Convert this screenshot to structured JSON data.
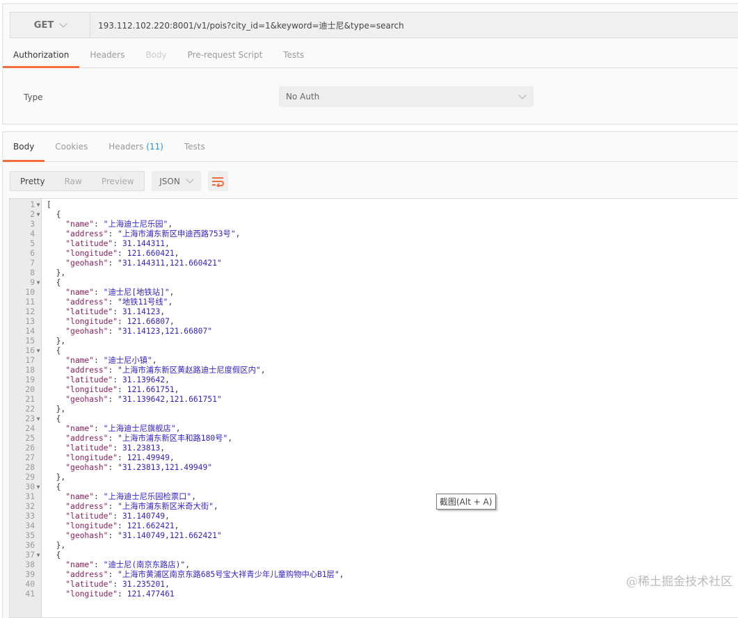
{
  "request": {
    "method": "GET",
    "url": "193.112.102.220:8001/v1/pois?city_id=1&keyword=迪士尼&type=search",
    "tabs": [
      {
        "label": "Authorization",
        "state": "active"
      },
      {
        "label": "Headers",
        "state": ""
      },
      {
        "label": "Body",
        "state": "disabled"
      },
      {
        "label": "Pre-request Script",
        "state": ""
      },
      {
        "label": "Tests",
        "state": ""
      }
    ],
    "auth": {
      "type_label": "Type",
      "type_value": "No Auth"
    }
  },
  "response": {
    "tabs": [
      {
        "label": "Body",
        "state": "active"
      },
      {
        "label": "Cookies",
        "state": ""
      },
      {
        "label": "Headers",
        "count": "(11)",
        "state": ""
      },
      {
        "label": "Tests",
        "state": ""
      }
    ],
    "views": [
      "Pretty",
      "Raw",
      "Preview"
    ],
    "active_view": "Pretty",
    "format": "JSON",
    "code_lines": [
      "[",
      "  {",
      "    \"name\": \"上海迪士尼乐园\",",
      "    \"address\": \"上海市浦东新区申迪西路753号\",",
      "    \"latitude\": 31.144311,",
      "    \"longitude\": 121.660421,",
      "    \"geohash\": \"31.144311,121.660421\"",
      "  },",
      "  {",
      "    \"name\": \"迪士尼[地铁站]\",",
      "    \"address\": \"地铁11号线\",",
      "    \"latitude\": 31.14123,",
      "    \"longitude\": 121.66807,",
      "    \"geohash\": \"31.14123,121.66807\"",
      "  },",
      "  {",
      "    \"name\": \"迪士尼小镇\",",
      "    \"address\": \"上海市浦东新区黄赵路迪士尼度假区内\",",
      "    \"latitude\": 31.139642,",
      "    \"longitude\": 121.661751,",
      "    \"geohash\": \"31.139642,121.661751\"",
      "  },",
      "  {",
      "    \"name\": \"上海迪士尼旗舰店\",",
      "    \"address\": \"上海市浦东新区丰和路180号\",",
      "    \"latitude\": 31.23813,",
      "    \"longitude\": 121.49949,",
      "    \"geohash\": \"31.23813,121.49949\"",
      "  },",
      "  {",
      "    \"name\": \"上海迪士尼乐园检票口\",",
      "    \"address\": \"上海市浦东新区米奇大街\",",
      "    \"latitude\": 31.140749,",
      "    \"longitude\": 121.662421,",
      "    \"geohash\": \"31.140749,121.662421\"",
      "  },",
      "  {",
      "    \"name\": \"迪士尼(南京东路店)\",",
      "    \"address\": \"上海市黄浦区南京东路685号宝大祥青少年儿童购物中心B1层\",",
      "    \"latitude\": 31.235201,",
      "    \"longitude\": 121.477461"
    ],
    "fold_lines": [
      1,
      2,
      9,
      16,
      23,
      30,
      37
    ]
  },
  "tooltip": "截图(Alt + A)",
  "watermark": "@稀土掘金技术社区",
  "colors": {
    "accent": "#f26b3a",
    "link": "#2a8fd6"
  }
}
